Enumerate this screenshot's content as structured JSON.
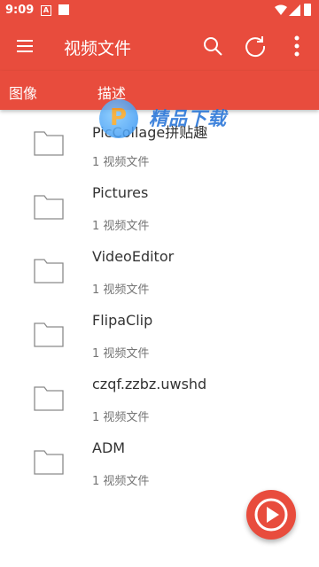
{
  "status_bar": {
    "time": "9:09",
    "a_badge": "A"
  },
  "app_bar": {
    "title": "视频文件"
  },
  "tabs": [
    {
      "label": "图像"
    },
    {
      "label": "描述"
    }
  ],
  "folders": [
    {
      "name": "PicCollage拼贴趣",
      "count": "1 视频文件"
    },
    {
      "name": "Pictures",
      "count": "1 视频文件"
    },
    {
      "name": "VideoEditor",
      "count": "1 视频文件"
    },
    {
      "name": "FlipaClip",
      "count": "1 视频文件"
    },
    {
      "name": "czqf.zzbz.uwshd",
      "count": "1 视频文件"
    },
    {
      "name": "ADM",
      "count": "1 视频文件"
    }
  ],
  "watermark": {
    "text": "精品下载"
  },
  "colors": {
    "primary": "#e84c3d",
    "background": "#ffffff"
  }
}
